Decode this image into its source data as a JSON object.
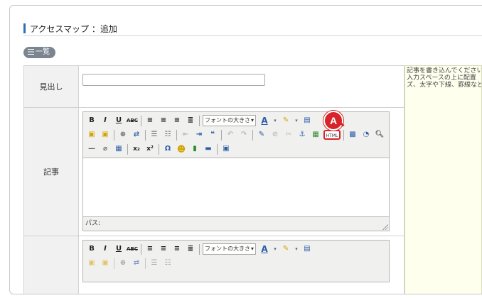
{
  "page": {
    "title": "アクセスマップ ：追加",
    "list_button_label": "一覧"
  },
  "form": {
    "rows": [
      {
        "label": "見出し"
      },
      {
        "label": "記事"
      },
      {
        "label": ""
      }
    ],
    "heading_input": {
      "value": "",
      "placeholder": ""
    },
    "editor": {
      "font_size_placeholder": "フォントの大きさ",
      "html_button_label": "HTML",
      "path_label": "パス:"
    }
  },
  "help_text": {
    "lines": [
      "記事を書き込んでください。",
      "入力スペースの上に配置",
      "ズ、太字や下線、罫線など"
    ]
  },
  "annotation": {
    "callout_letter": "A",
    "color": "#d6242a"
  },
  "colors": {
    "accent": "#2f6fb5",
    "help_background": "#ffffee",
    "label_background": "#f1f1f1"
  }
}
